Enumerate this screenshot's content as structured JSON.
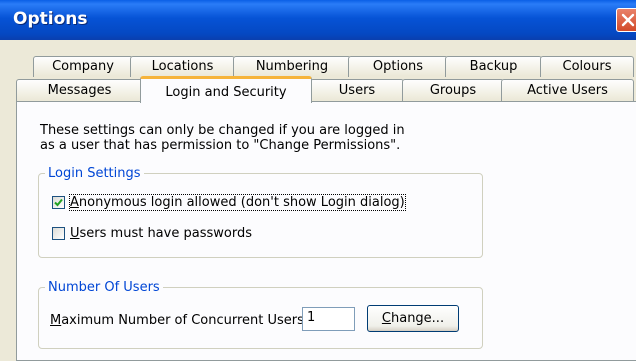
{
  "window": {
    "title": "Options"
  },
  "tabs": {
    "row1": [
      {
        "label": "Company"
      },
      {
        "label": "Locations"
      },
      {
        "label": "Numbering"
      },
      {
        "label": "Options"
      },
      {
        "label": "Backup"
      },
      {
        "label": "Colours"
      }
    ],
    "row2": [
      {
        "label": "Messages"
      },
      {
        "label": "Login and Security",
        "selected": true
      },
      {
        "label": "Users"
      },
      {
        "label": "Groups"
      },
      {
        "label": "Active Users"
      }
    ]
  },
  "panel": {
    "info_line1": "These settings can only be changed if you are logged in",
    "info_line2": "as a user that has permission to \"Change Permissions\"."
  },
  "login_settings": {
    "legend": "Login Settings",
    "anonymous_label_mnemonic": "A",
    "anonymous_label_rest": "nonymous login allowed (don't show Login dialog)",
    "anonymous_checked": true,
    "passwords_label_mnemonic": "U",
    "passwords_label_rest": "sers must have passwords",
    "passwords_checked": false
  },
  "number_of_users": {
    "legend": "Number Of Users",
    "max_label_mnemonic": "M",
    "max_label_rest": "aximum Number of Concurrent Users:",
    "max_value": "1",
    "change_button_mnemonic": "C",
    "change_button_rest": "hange..."
  },
  "colors": {
    "titlebar": "#0653d6",
    "face": "#ece9d8",
    "legend_text": "#0046d5",
    "active_tab_highlight": "#f6b43a",
    "checkmark": "#21a121"
  }
}
